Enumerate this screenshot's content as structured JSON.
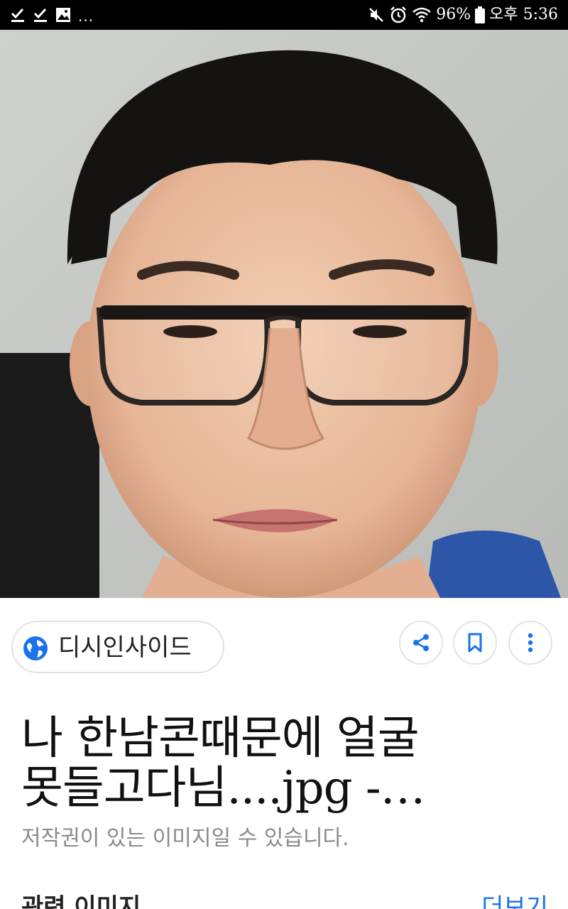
{
  "status_bar": {
    "left_icons": [
      "check-icon",
      "check-icon",
      "image-icon"
    ],
    "overflow": "...",
    "right_icons": [
      "mute-icon",
      "alarm-icon",
      "wifi-icon",
      "battery-icon"
    ],
    "battery": "96%",
    "time": "오후 5:36"
  },
  "hero": {
    "image": "photo-portrait"
  },
  "source": {
    "icon": "globe-icon",
    "name": "디시인사이드"
  },
  "actions": {
    "share_icon": "share-icon",
    "bookmark_icon": "bookmark-icon",
    "more_icon": "more-vert-icon"
  },
  "result": {
    "title_line1": "나 한남콘때문에 얼굴",
    "title_line2": "못들고다님....jpg -…",
    "copyright_notice": "저작권이 있는 이미지일 수 있습니다."
  },
  "related": {
    "label": "관련 이미지",
    "more_link": "더보기"
  },
  "colors": {
    "accent": "#1a73e8",
    "status_bar_bg": "#000000",
    "muted_text": "#8a8a8a"
  }
}
